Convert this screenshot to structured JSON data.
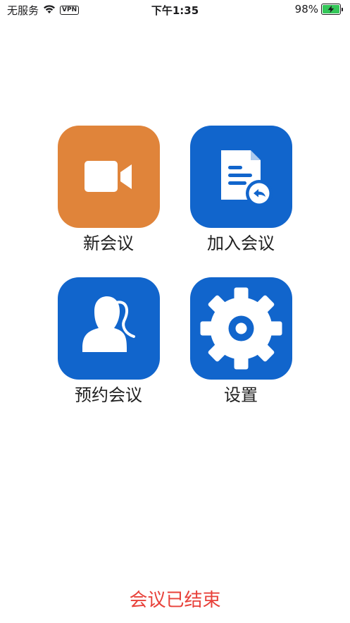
{
  "status_bar": {
    "carrier": "无服务",
    "vpn": "VPN",
    "time": "下午1:35",
    "battery_percent": "98%",
    "battery_level": 0.98,
    "battery_color": "#34c759"
  },
  "tiles": [
    {
      "label": "新会议",
      "icon": "video-camera-icon",
      "color": "#e0843a"
    },
    {
      "label": "加入会议",
      "icon": "join-document-icon",
      "color": "#1165cc"
    },
    {
      "label": "预约会议",
      "icon": "contact-person-icon",
      "color": "#1165cc"
    },
    {
      "label": "设置",
      "icon": "gear-icon",
      "color": "#1165cc"
    }
  ],
  "footer": {
    "status_text": "会议已结束",
    "status_color": "#e8413a"
  }
}
